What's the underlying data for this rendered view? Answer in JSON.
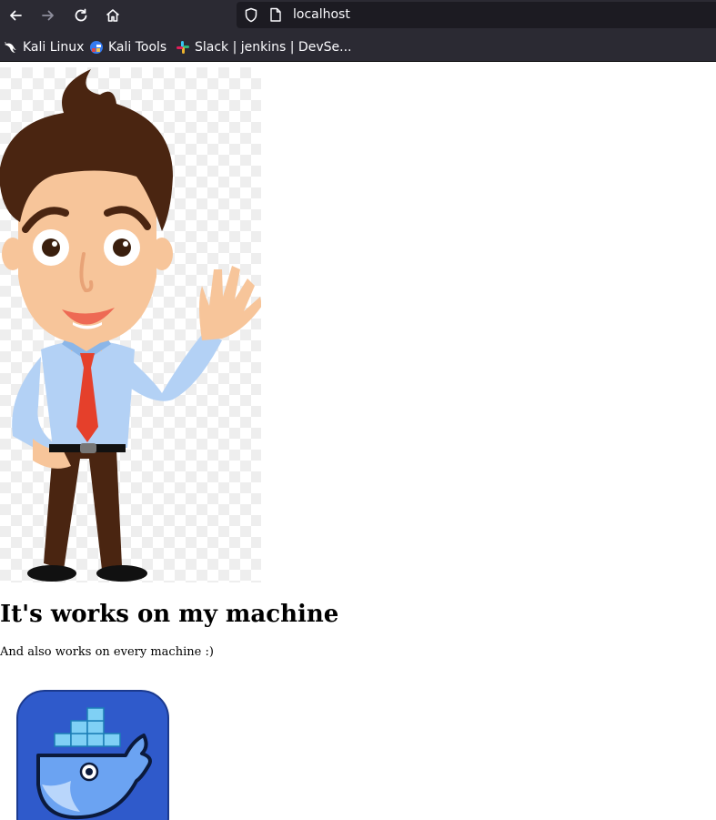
{
  "browser": {
    "url": "localhost",
    "bookmarks": [
      {
        "label": "Kali Linux",
        "icon": "kali-dragon-icon"
      },
      {
        "label": "Kali Tools",
        "icon": "kali-tools-icon"
      },
      {
        "label": "Slack | jenkins | DevSe...",
        "icon": "slack-icon"
      }
    ],
    "colors": {
      "toolbar": "#2b2a33",
      "urlbar": "#1c1b22",
      "text": "#fbfbfe"
    }
  },
  "page": {
    "heading": "It's works on my machine",
    "paragraph": "And also works on every machine :)",
    "images": [
      {
        "name": "waving-cartoon-man-image",
        "description_icon": "cartoon-man"
      },
      {
        "name": "docker-logo-image",
        "description_icon": "docker-whale"
      }
    ]
  }
}
